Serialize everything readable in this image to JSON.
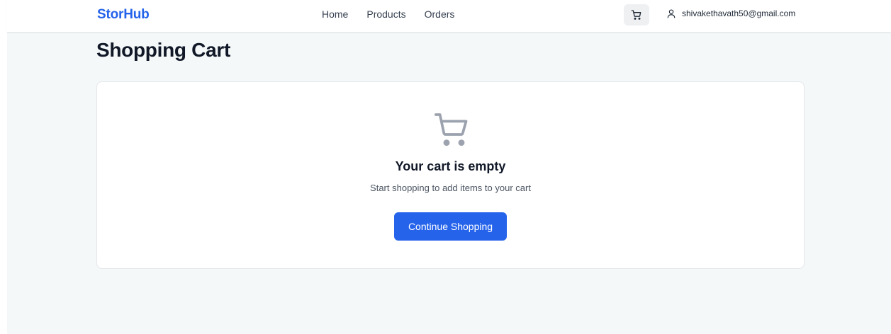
{
  "brand": {
    "name": "StorHub",
    "color": "#2563eb"
  },
  "nav": {
    "links": [
      {
        "label": "Home"
      },
      {
        "label": "Products"
      },
      {
        "label": "Orders"
      }
    ],
    "cart_icon": "shopping-cart-icon",
    "user_icon": "user-icon",
    "user_email": "shivakethavath50@gmail.com"
  },
  "page": {
    "title": "Shopping Cart"
  },
  "empty_state": {
    "icon": "shopping-cart-icon",
    "title": "Your cart is empty",
    "subtitle": "Start shopping to add items to your cart",
    "button_label": "Continue Shopping",
    "button_color": "#2563eb"
  }
}
